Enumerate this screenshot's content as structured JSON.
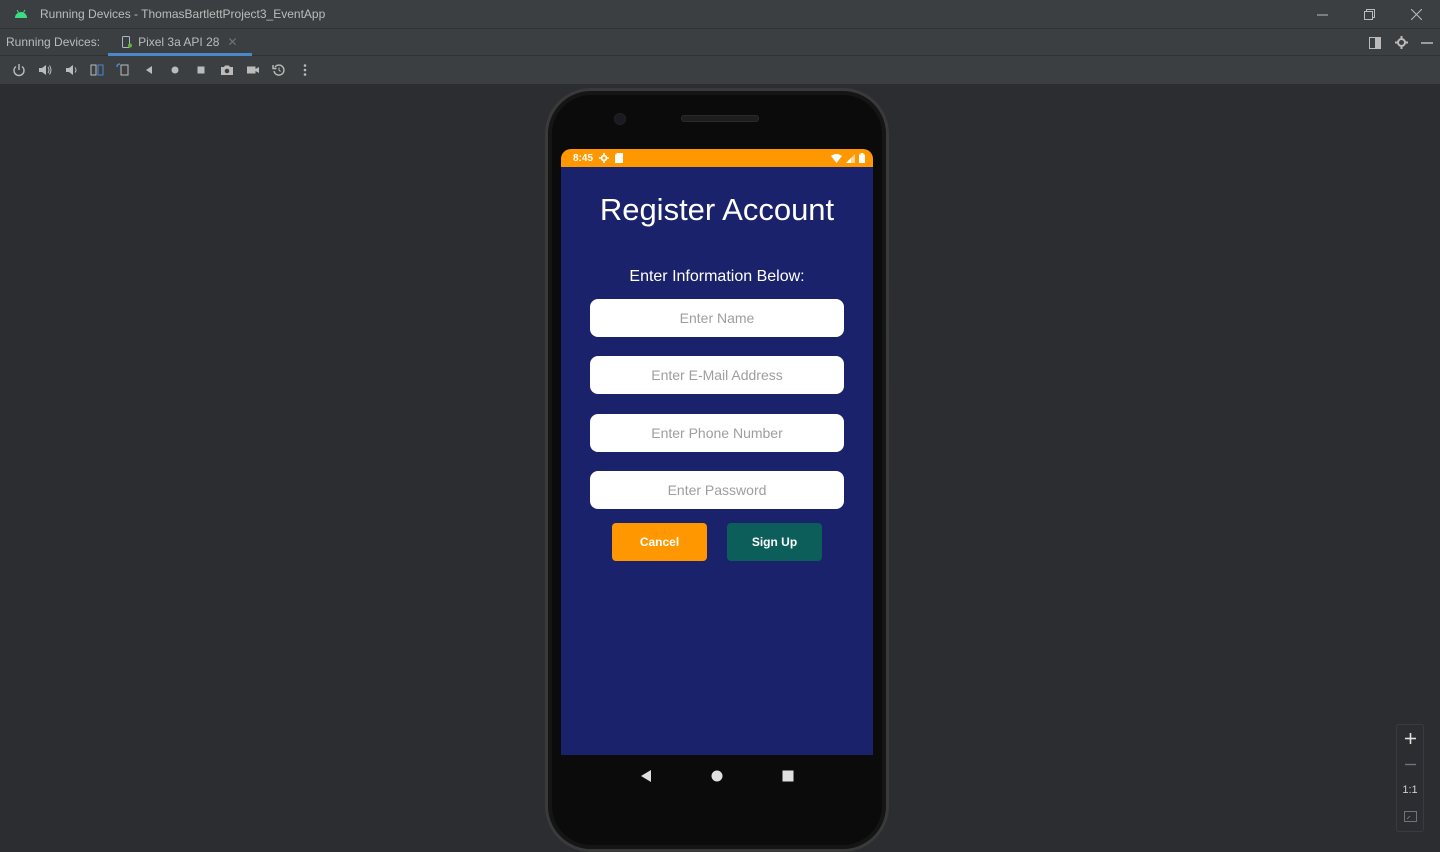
{
  "window": {
    "title": "Running Devices - ThomasBartlettProject3_EventApp",
    "controls": [
      "minimize",
      "restore",
      "close"
    ]
  },
  "tool_window": {
    "label": "Running Devices:",
    "tabs": [
      {
        "label": "Pixel 3a API 28",
        "active": true
      }
    ]
  },
  "toolbar_icons": [
    "power-icon",
    "volume-up-icon",
    "volume-down-icon",
    "rotate-left-icon",
    "rotate-right-icon",
    "back-icon",
    "home-icon",
    "overview-icon",
    "screenshot-icon",
    "screen-record-icon",
    "reset-icon",
    "more-icon"
  ],
  "device": {
    "status_bar": {
      "time": "8:45",
      "color": "#ff9800"
    },
    "screen_bg": "#1a226b",
    "app": {
      "title": "Register Account",
      "subtitle": "Enter Information Below:",
      "fields": {
        "name": {
          "placeholder": "Enter Name",
          "value": ""
        },
        "email": {
          "placeholder": "Enter E-Mail Address",
          "value": ""
        },
        "phone": {
          "placeholder": "Enter Phone Number",
          "value": ""
        },
        "password": {
          "placeholder": "Enter Password",
          "value": ""
        }
      },
      "buttons": {
        "cancel": {
          "label": "Cancel",
          "color": "#ff9800"
        },
        "signup": {
          "label": "Sign Up",
          "color": "#0b5e5a"
        }
      }
    }
  },
  "zoom": {
    "ratio_label": "1:1"
  }
}
